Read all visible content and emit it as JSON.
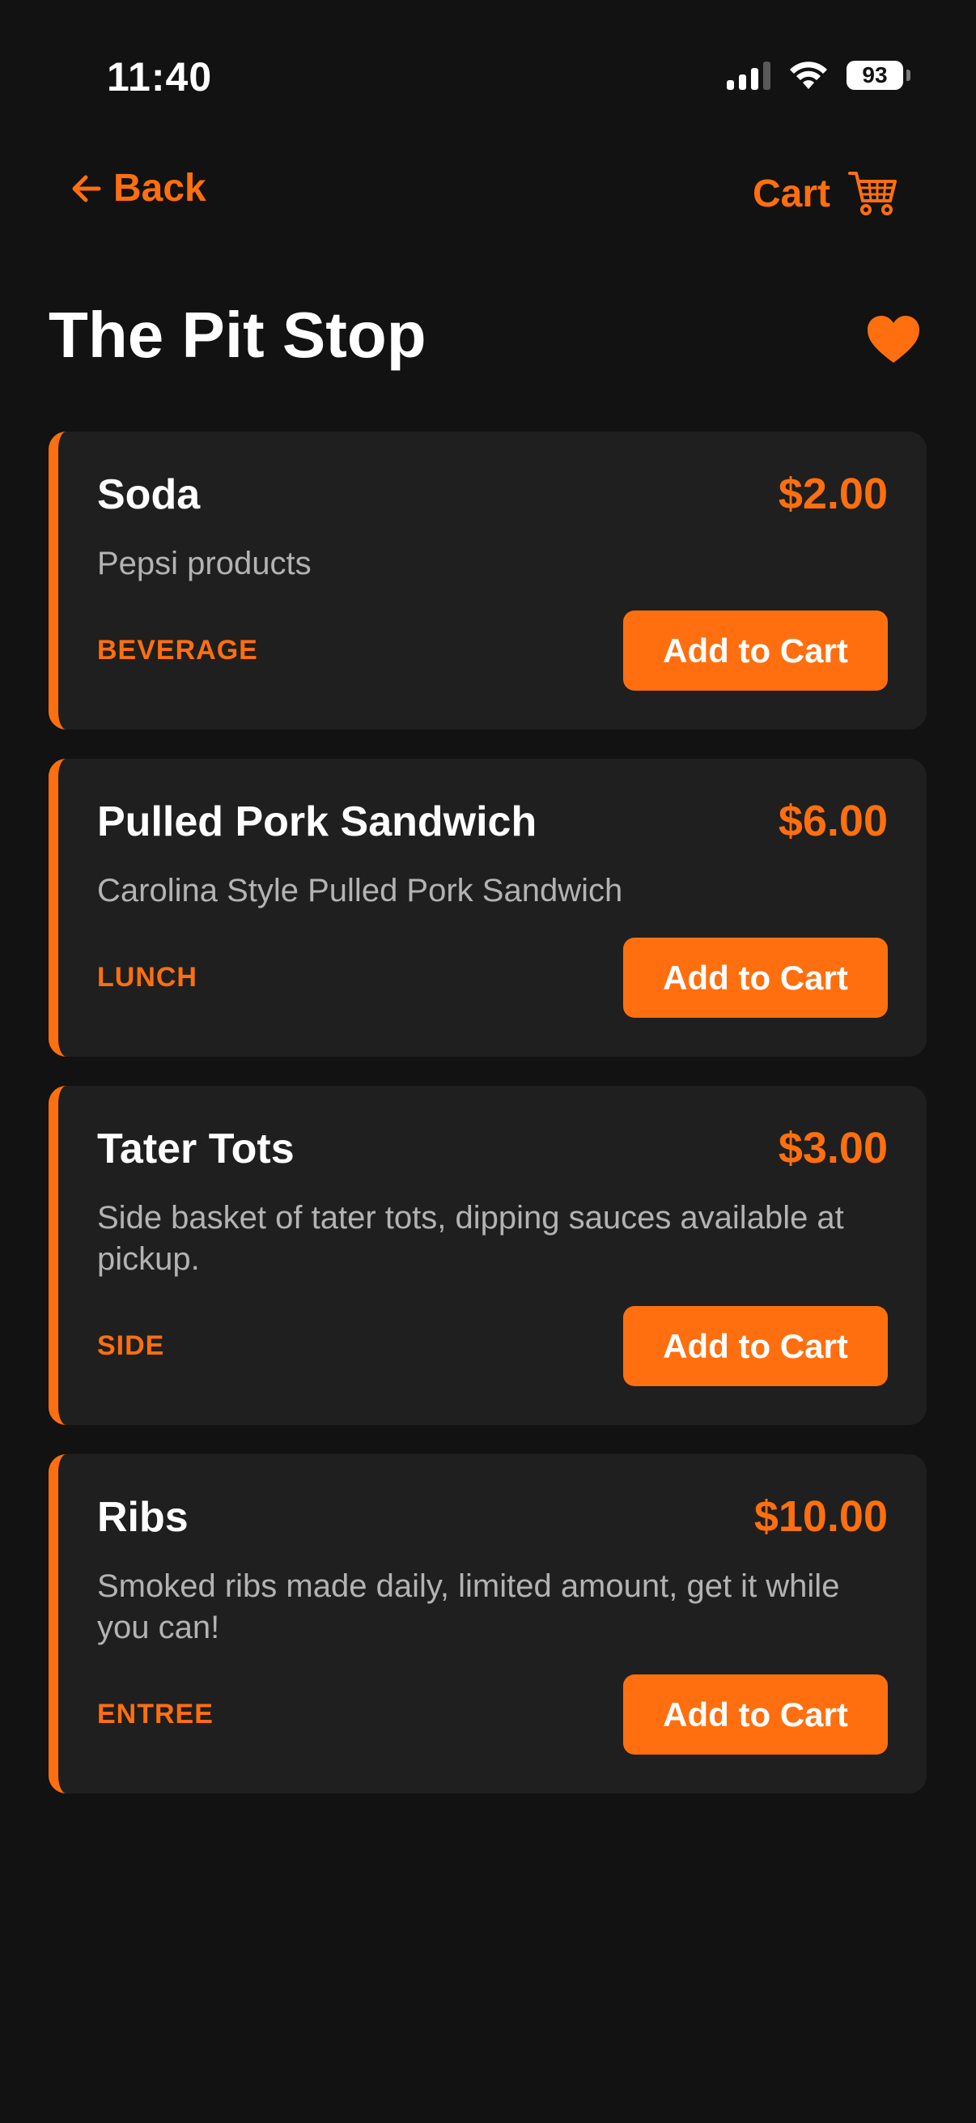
{
  "status_bar": {
    "time": "11:40",
    "battery": "93"
  },
  "nav": {
    "back_label": "Back",
    "cart_label": "Cart"
  },
  "page": {
    "title": "The Pit Stop"
  },
  "items": [
    {
      "name": "Soda",
      "price": "$2.00",
      "description": "Pepsi products",
      "category": "BEVERAGE",
      "button_label": "Add to Cart"
    },
    {
      "name": "Pulled Pork Sandwich",
      "price": "$6.00",
      "description": "Carolina Style Pulled Pork Sandwich",
      "category": "LUNCH",
      "button_label": "Add to Cart"
    },
    {
      "name": "Tater Tots",
      "price": "$3.00",
      "description": "Side basket of tater tots, dipping sauces available at pickup.",
      "category": "SIDE",
      "button_label": "Add to Cart"
    },
    {
      "name": "Ribs",
      "price": "$10.00",
      "description": "Smoked ribs made daily, limited amount, get it while you can!",
      "category": "ENTREE",
      "button_label": "Add to Cart"
    }
  ],
  "colors": {
    "accent": "#FF6F0F",
    "background": "#121212",
    "card": "#1F1F1F",
    "muted_text": "#B3B3B3"
  },
  "icons": {
    "back": "arrow-left-icon",
    "cart": "shopping-cart-icon",
    "favorite": "heart-icon",
    "signal": "cellular-signal-icon",
    "wifi": "wifi-icon",
    "battery": "battery-icon"
  }
}
